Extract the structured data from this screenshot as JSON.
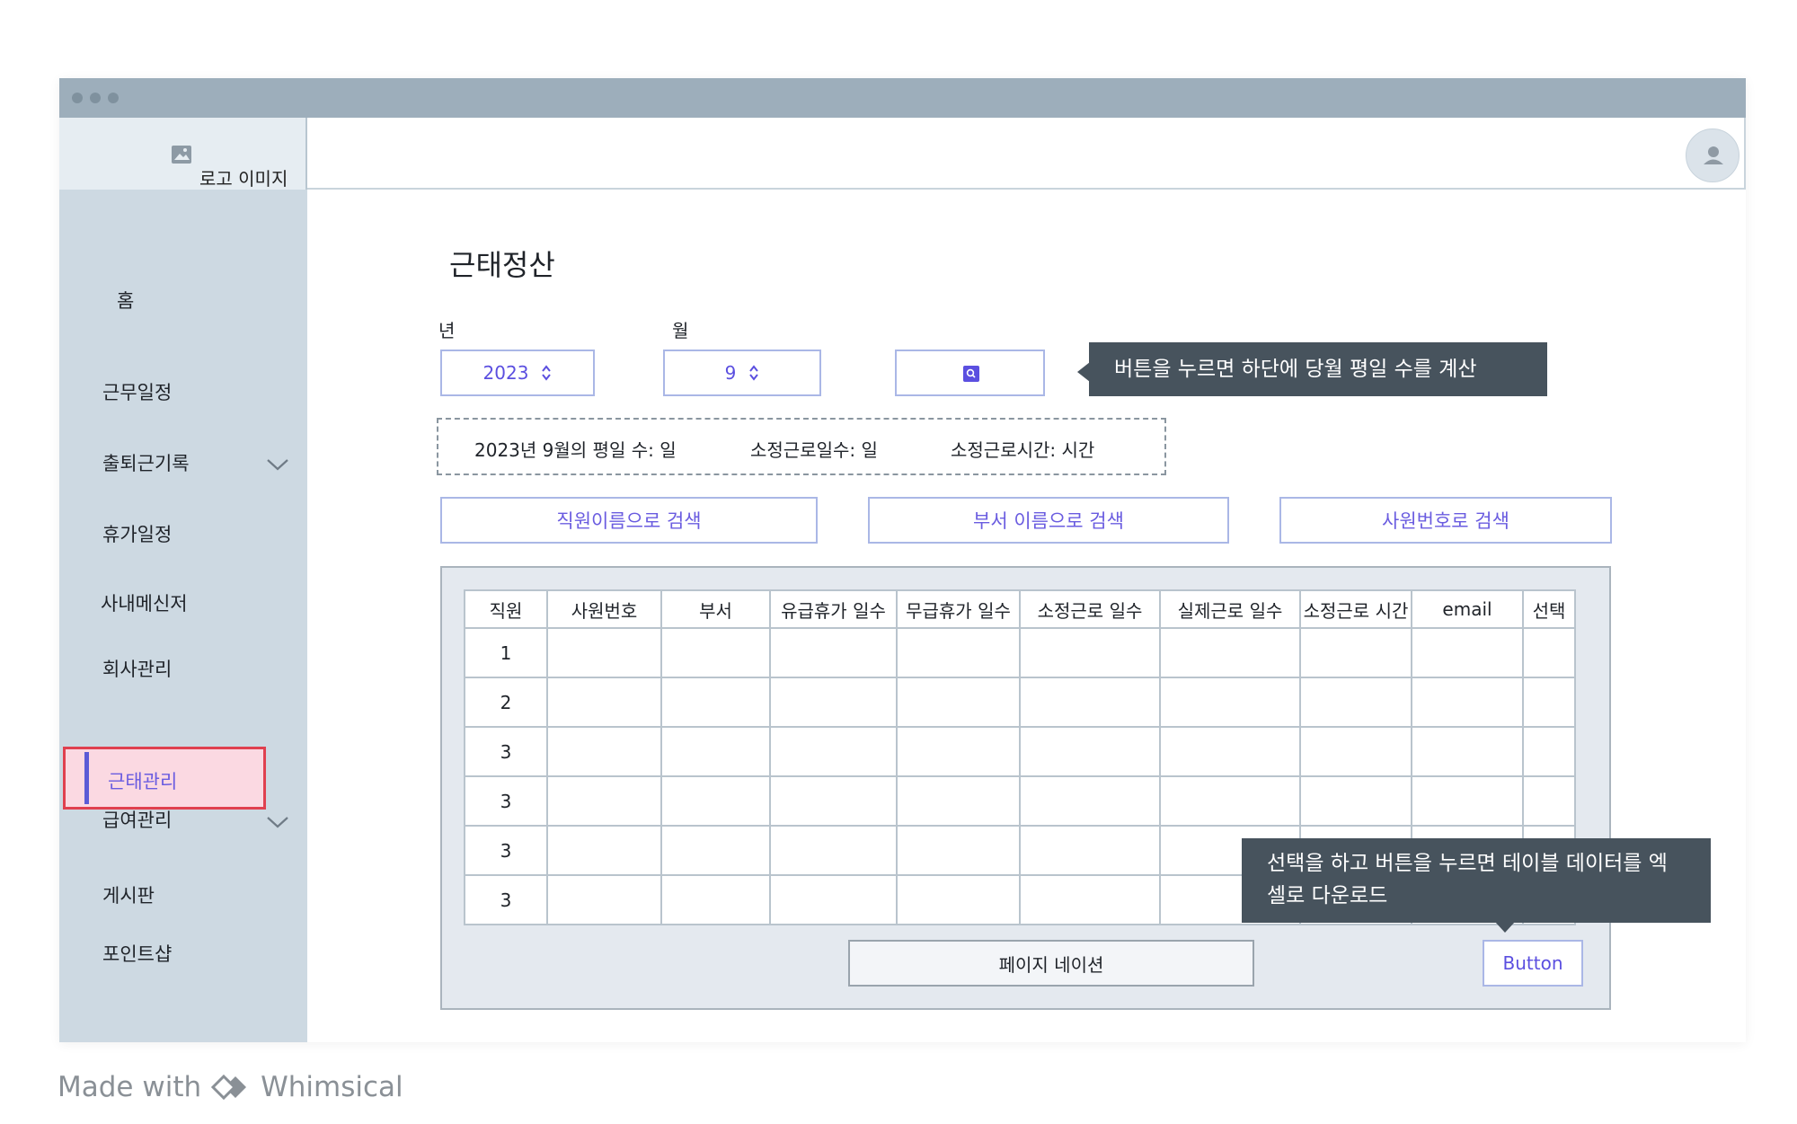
{
  "header": {
    "logo_text": "로고 이미지"
  },
  "sidebar": {
    "items": [
      {
        "label": "홈"
      },
      {
        "label": "근무일정"
      },
      {
        "label": "출퇴근기록"
      },
      {
        "label": "휴가일정"
      },
      {
        "label": "사내메신저"
      },
      {
        "label": "회사관리"
      },
      {
        "label": "근태관리"
      },
      {
        "label": "급여관리"
      },
      {
        "label": "게시판"
      },
      {
        "label": "포인트샵"
      }
    ]
  },
  "main": {
    "title": "근태정산",
    "year_label": "년",
    "month_label": "월",
    "year_value": "2023",
    "month_value": "9",
    "tooltip_calc": "버튼을 누르면 하단에 당월 평일 수를 계산",
    "info": {
      "weekdays": "2023년 9월의 평일 수: 일",
      "scheduled_days": "소정근로일수: 일",
      "scheduled_hours": "소정근로시간: 시간"
    },
    "search_buttons": {
      "by_name": "직원이름으로 검색",
      "by_dept": "부서 이름으로 검색",
      "by_id": "사원번호로 검색"
    },
    "table": {
      "headers": [
        "직원",
        "사원번호",
        "부서",
        "유급휴가 일수",
        "무급휴가 일수",
        "소정근로 일수",
        "실제근로 일수",
        "소정근로 시간",
        "email",
        "선택"
      ],
      "rows": [
        "1",
        "2",
        "3",
        "3",
        "3",
        "3"
      ]
    },
    "pagination_label": "페이지 네이션",
    "action_button": "Button",
    "tooltip_download": "선택을 하고 버튼을 누르면 테이블 데이터를 엑셀로 다운로드"
  },
  "footer": {
    "made_with": "Made with",
    "brand": "Whimsical"
  }
}
